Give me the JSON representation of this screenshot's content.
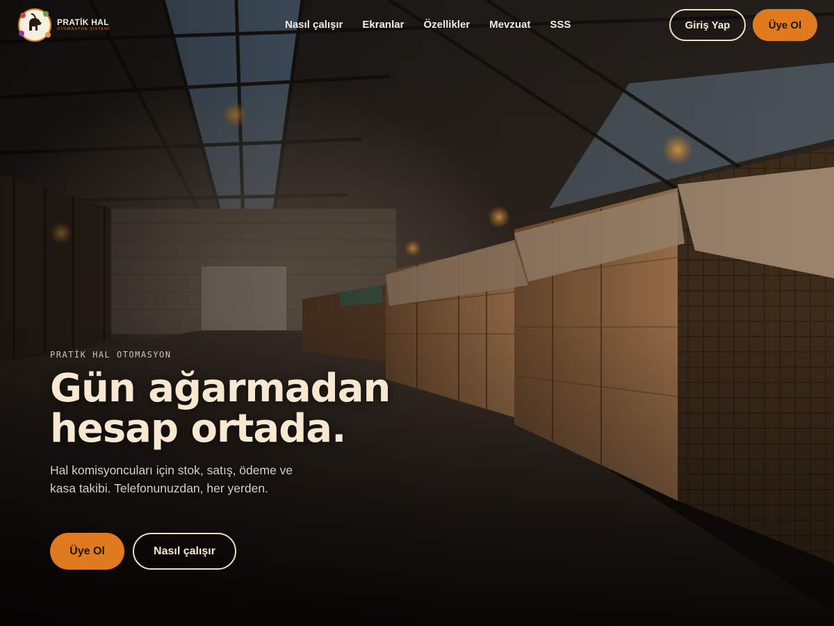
{
  "brand": {
    "name": "PRATİK HAL",
    "tagline": "OTOMASYON SİSTEMİ",
    "logo_icon": "goat-emblem-icon",
    "accent_color": "#e07a1f"
  },
  "nav": {
    "items": [
      {
        "label": "Nasıl çalışır"
      },
      {
        "label": "Ekranlar"
      },
      {
        "label": "Özellikler"
      },
      {
        "label": "Mevzuat"
      },
      {
        "label": "SSS"
      }
    ]
  },
  "header_actions": {
    "login_label": "Giriş Yap",
    "signup_label": "Üye Ol"
  },
  "hero": {
    "eyebrow": "PRATİK HAL OTOMASYON",
    "headline_line1": "Gün ağarmadan",
    "headline_line2": "hesap ortada.",
    "subtext": "Hal komisyoncuları için stok, satış, ödeme ve kasa takibi. Telefonunuzdan, her yerden.",
    "primary_cta": "Üye Ol",
    "secondary_cta": "Nasıl çalışır",
    "background": "warehouse-with-produce-crates"
  }
}
